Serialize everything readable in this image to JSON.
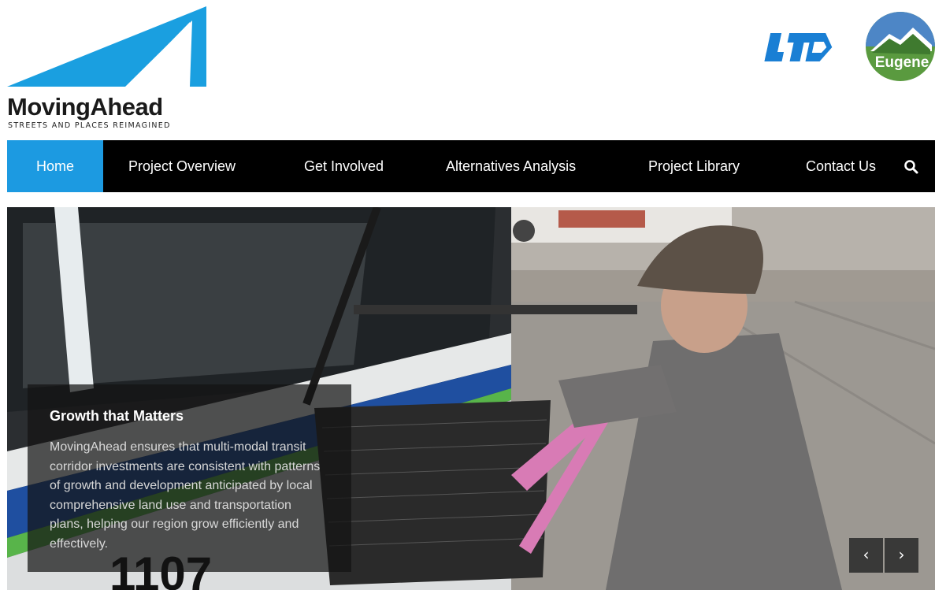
{
  "brand": {
    "name": "MovingAhead",
    "tagline": "STREETS AND PLACES REIMAGINED",
    "accent_color": "#1c9ae1"
  },
  "partners": {
    "ltd_logo": "LTD",
    "eugene_logo": "Eugene"
  },
  "nav": {
    "items": [
      {
        "label": "Home",
        "active": true
      },
      {
        "label": "Project Overview",
        "active": false
      },
      {
        "label": "Get Involved",
        "active": false
      },
      {
        "label": "Alternatives Analysis",
        "active": false
      },
      {
        "label": "Project Library",
        "active": false
      },
      {
        "label": "Contact Us",
        "active": false
      }
    ],
    "search_icon": "search-icon"
  },
  "hero": {
    "title": "Growth that Matters",
    "body": "MovingAhead ensures that multi-modal transit corridor investments are consistent with patterns of growth and development anticipated by local comprehensive land use and transportation plans, helping our region grow efficiently and effectively.",
    "bus_number": "1107",
    "prev_icon": "‹",
    "next_icon": "›"
  }
}
